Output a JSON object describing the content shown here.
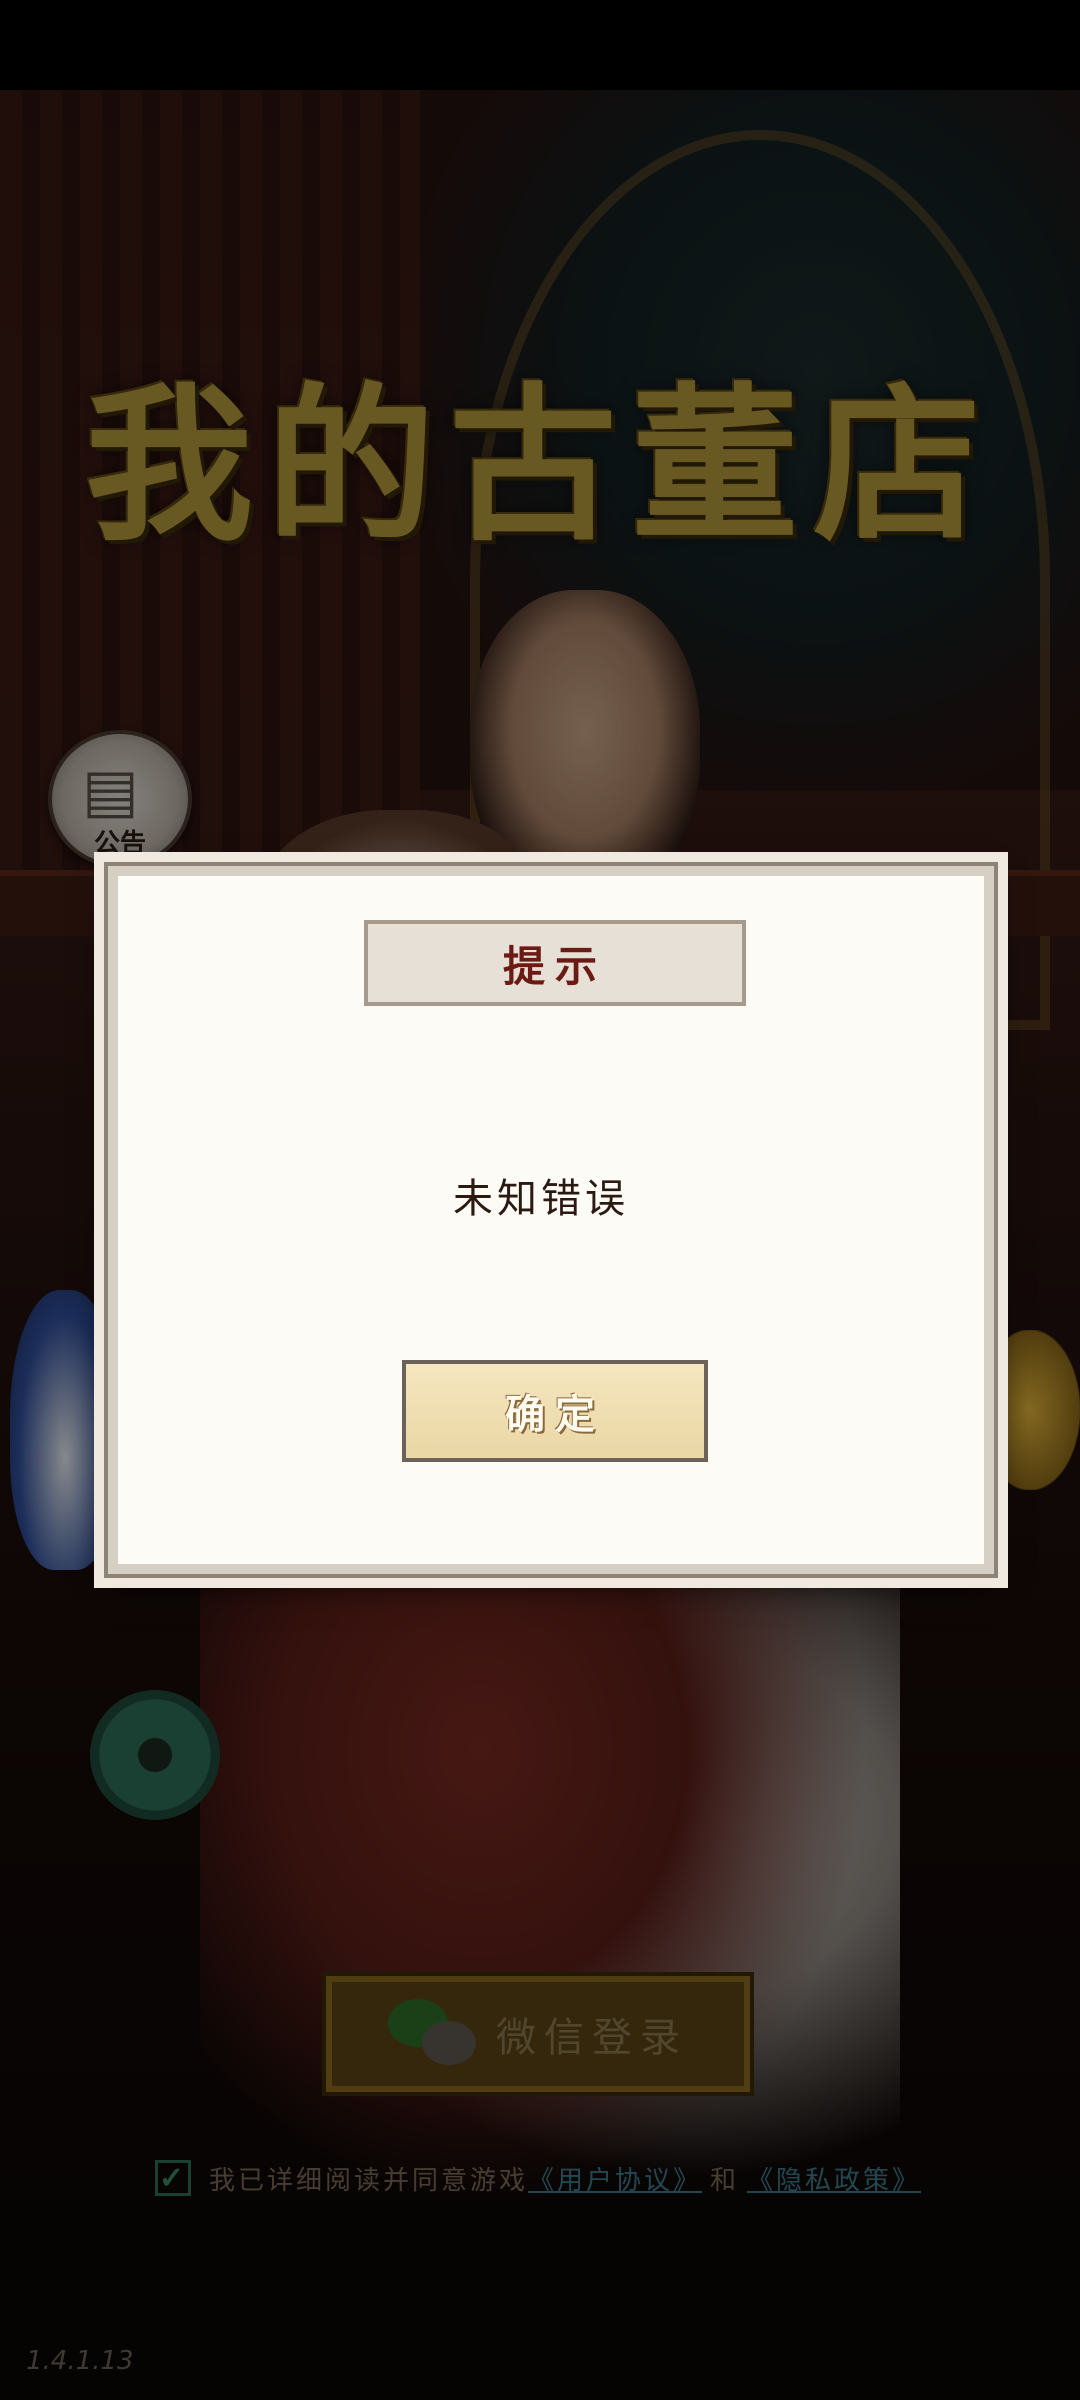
{
  "game": {
    "title": "我的古董店",
    "version": "1.4.1.13"
  },
  "notice": {
    "label": "公告",
    "icon": "newspaper-icon"
  },
  "dialog": {
    "title": "提示",
    "message": "未知错误",
    "confirm_label": "确定"
  },
  "login": {
    "wechat_label": "微信登录",
    "wechat_icon": "wechat-icon"
  },
  "agreement": {
    "checked": true,
    "check_glyph": "✓",
    "text": "我已详细阅读并同意游戏",
    "user_agreement": "《用户协议》",
    "and": "和",
    "privacy_policy": "《隐私政策》"
  },
  "colors": {
    "title_gold": "#b49a3c",
    "dialog_bg": "#fdfbf5",
    "dialog_title_text": "#6b1a14",
    "confirm_bg": "#f5e6bf",
    "link": "#3d7a8c",
    "check": "#3c8c66"
  }
}
